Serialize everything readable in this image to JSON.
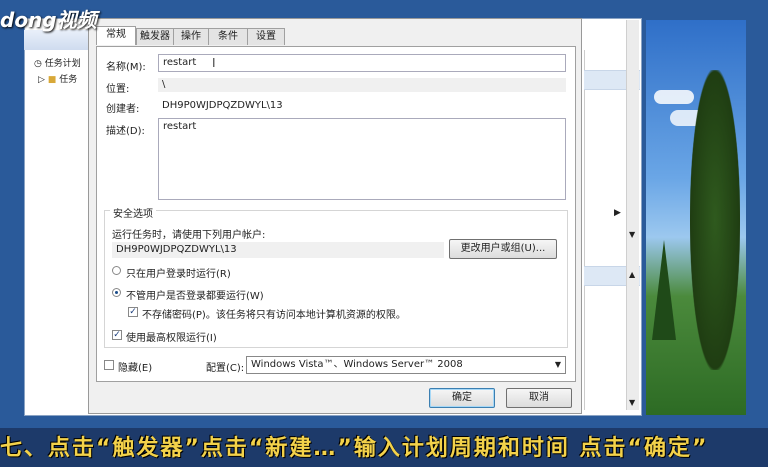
{
  "watermark": "dong视频",
  "scheduler": {
    "tree": [
      "任务计划",
      "任务"
    ]
  },
  "dialog": {
    "tabs": [
      "常规",
      "触发器",
      "操作",
      "条件",
      "设置"
    ],
    "name_label": "名称(M):",
    "name_value": "restart",
    "location_label": "位置:",
    "location_value": "\\",
    "author_label": "创建者:",
    "author_value": "DH9P0WJDPQZDWYL\\13",
    "desc_label": "描述(D):",
    "desc_value": "restart",
    "security": {
      "title": "安全选项",
      "run_as_prompt": "运行任务时，请使用下列用户帐户:",
      "run_as_user": "DH9P0WJDPQZDWYL\\13",
      "change_user_button": "更改用户或组(U)...",
      "radio_logged_on": "只在用户登录时运行(R)",
      "radio_whether": "不管用户是否登录都要运行(W)",
      "no_store_password": "不存储密码(P)。该任务将只有访问本地计算机资源的权限。",
      "highest_privileges": "使用最高权限运行(I)"
    },
    "hidden_label": "隐藏(E)",
    "config_label": "配置(C):",
    "config_value": "Windows Vista™、Windows Server™ 2008",
    "ok_button": "确定",
    "cancel_button": "取消"
  },
  "subtitle": "七、点击“触发器”点击“新建…”输入计划周期和时间 点击“确定”"
}
